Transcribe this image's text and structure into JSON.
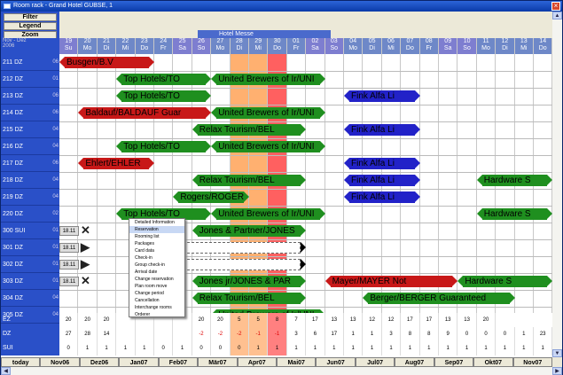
{
  "window": {
    "title": "Room rack - Grand Hotel GUBSE, 1"
  },
  "buttons": {
    "filter": "Filter",
    "legend": "Legend",
    "zoom": "Zoom"
  },
  "header": {
    "month_range": "Nov - Dez",
    "year": "2006",
    "event": "Hotel Messe"
  },
  "days": [
    {
      "d": "19",
      "w": "Su"
    },
    {
      "d": "20",
      "w": "Mo"
    },
    {
      "d": "21",
      "w": "Di"
    },
    {
      "d": "22",
      "w": "Mi"
    },
    {
      "d": "23",
      "w": "Do"
    },
    {
      "d": "24",
      "w": "Fr"
    },
    {
      "d": "25",
      "w": "Sa"
    },
    {
      "d": "26",
      "w": "So"
    },
    {
      "d": "27",
      "w": "Mo"
    },
    {
      "d": "28",
      "w": "Di"
    },
    {
      "d": "29",
      "w": "Mi"
    },
    {
      "d": "30",
      "w": "Do"
    },
    {
      "d": "01",
      "w": "Fr"
    },
    {
      "d": "02",
      "w": "Sa"
    },
    {
      "d": "03",
      "w": "So"
    },
    {
      "d": "04",
      "w": "Mo"
    },
    {
      "d": "05",
      "w": "Di"
    },
    {
      "d": "06",
      "w": "Mi"
    },
    {
      "d": "07",
      "w": "Do"
    },
    {
      "d": "08",
      "w": "Fr"
    },
    {
      "d": "09",
      "w": "Sa"
    },
    {
      "d": "10",
      "w": "So"
    },
    {
      "d": "11",
      "w": "Mo"
    },
    {
      "d": "12",
      "w": "Di"
    },
    {
      "d": "13",
      "w": "Mi"
    },
    {
      "d": "14",
      "w": "Do"
    }
  ],
  "rooms": [
    {
      "name": "211 DZ",
      "n": "06"
    },
    {
      "name": "212 DZ",
      "n": "01"
    },
    {
      "name": "213 DZ",
      "n": "06"
    },
    {
      "name": "214 DZ",
      "n": "06"
    },
    {
      "name": "215 DZ",
      "n": "04"
    },
    {
      "name": "216 DZ",
      "n": "04"
    },
    {
      "name": "217 DZ",
      "n": "06"
    },
    {
      "name": "218 DZ",
      "n": "04"
    },
    {
      "name": "219 DZ",
      "n": "04"
    },
    {
      "name": "220 DZ",
      "n": "02"
    },
    {
      "name": "300 SUI",
      "n": "01"
    },
    {
      "name": "301 DZ",
      "n": "01"
    },
    {
      "name": "302 DZ",
      "n": "01"
    },
    {
      "name": "303 DZ",
      "n": "01"
    },
    {
      "name": "304 DZ",
      "n": "04"
    },
    {
      "name": "305 DZ",
      "n": "04"
    }
  ],
  "bookings": [
    {
      "row": 0,
      "s": 0,
      "e": 5,
      "c": "red",
      "t": "Busgen/B.V"
    },
    {
      "row": 1,
      "s": 3,
      "e": 8,
      "c": "g",
      "t": "Top Hotels/TO"
    },
    {
      "row": 1,
      "s": 8,
      "e": 14,
      "c": "g",
      "t": "United Brewers of Ir/UNI"
    },
    {
      "row": 2,
      "s": 3,
      "e": 8,
      "c": "g",
      "t": "Top Hotels/TO"
    },
    {
      "row": 2,
      "s": 15,
      "e": 19,
      "c": "b",
      "t": "Fink Alfa Li"
    },
    {
      "row": 3,
      "s": 1,
      "e": 8,
      "c": "red",
      "t": "Baldauf/BALDAUF Guar"
    },
    {
      "row": 3,
      "s": 8,
      "e": 14,
      "c": "g",
      "t": "United Brewers of Ir/UNI"
    },
    {
      "row": 4,
      "s": 7,
      "e": 13,
      "c": "g",
      "t": "Relax Tourism/BEL"
    },
    {
      "row": 4,
      "s": 15,
      "e": 19,
      "c": "b",
      "t": "Fink Alfa Li"
    },
    {
      "row": 5,
      "s": 3,
      "e": 8,
      "c": "g",
      "t": "Top Hotels/TO"
    },
    {
      "row": 5,
      "s": 8,
      "e": 14,
      "c": "g",
      "t": "United Brewers of Ir/UNI"
    },
    {
      "row": 6,
      "s": 1,
      "e": 5,
      "c": "red",
      "t": "Ehlert/EHLER"
    },
    {
      "row": 6,
      "s": 15,
      "e": 19,
      "c": "b",
      "t": "Fink Alfa Li"
    },
    {
      "row": 7,
      "s": 7,
      "e": 13,
      "c": "g",
      "t": "Relax Tourism/BEL"
    },
    {
      "row": 7,
      "s": 15,
      "e": 19,
      "c": "b",
      "t": "Fink Alfa Li"
    },
    {
      "row": 7,
      "s": 22,
      "e": 26,
      "c": "g",
      "t": "Hardware S"
    },
    {
      "row": 8,
      "s": 6,
      "e": 10,
      "c": "g",
      "t": "Rogers/ROGER"
    },
    {
      "row": 8,
      "s": 15,
      "e": 19,
      "c": "b",
      "t": "Fink Alfa Li"
    },
    {
      "row": 9,
      "s": 3,
      "e": 8,
      "c": "g",
      "t": "Top Hotels/TO"
    },
    {
      "row": 9,
      "s": 8,
      "e": 14,
      "c": "g",
      "t": "United Brewers of Ir/UNI"
    },
    {
      "row": 9,
      "s": 22,
      "e": 26,
      "c": "g",
      "t": "Hardware S"
    },
    {
      "row": 10,
      "s": 7,
      "e": 13,
      "c": "g",
      "t": "Jones & Partner/JONES"
    },
    {
      "row": 11,
      "s": 6,
      "e": 13,
      "c": "w",
      "t": ""
    },
    {
      "row": 12,
      "s": 6,
      "e": 13,
      "c": "w",
      "t": ""
    },
    {
      "row": 13,
      "s": 7,
      "e": 13,
      "c": "g",
      "t": "Jones jr/JONES & PAR"
    },
    {
      "row": 13,
      "s": 14,
      "e": 21,
      "c": "red",
      "t": "Mayer/MAYER Not"
    },
    {
      "row": 13,
      "s": 21,
      "e": 26,
      "c": "g",
      "t": "Hardware S"
    },
    {
      "row": 14,
      "s": 7,
      "e": 13,
      "c": "g",
      "t": "Relax Tourism/BEL"
    },
    {
      "row": 14,
      "s": 16,
      "e": 24,
      "c": "g",
      "t": "Berger/BERGER Guaranteed"
    },
    {
      "row": 15,
      "s": 8,
      "e": 14,
      "c": "g",
      "t": "United Brewers of Ir/UNI"
    }
  ],
  "checkin_tags": [
    "18.11",
    "18.11",
    "18.11",
    "18.11",
    "18.11"
  ],
  "context_menu": [
    "Detailed Information",
    "Reservation",
    "Rooming list",
    "Packages",
    "Card data",
    "Check-in",
    "Group check-in",
    "Arrival date",
    "Change reservation",
    "Plan room move",
    "Change period",
    "Cancellation",
    "Interchange rooms",
    "Orderer"
  ],
  "context_selected": 1,
  "summary": {
    "labels": [
      "EZ",
      "DZ",
      "SUI"
    ],
    "ez": [
      "20",
      "20",
      "20",
      "",
      "",
      "",
      "",
      "20",
      "20",
      "5",
      "5",
      "8",
      "7",
      "17",
      "13",
      "13",
      "12",
      "12",
      "17",
      "17",
      "13",
      "13",
      "20"
    ],
    "dz": [
      "27",
      "28",
      "14",
      "",
      "",
      "",
      "",
      "-2",
      "-2",
      "-2",
      "-1",
      "-1",
      "3",
      "6",
      "17",
      "1",
      "1",
      "3",
      "8",
      "8",
      "9",
      "0",
      "0",
      "0",
      "1",
      "23"
    ],
    "sui": [
      "0",
      "1",
      "1",
      "1",
      "1",
      "0",
      "1",
      "0",
      "0",
      "0",
      "1",
      "1",
      "1",
      "1",
      "1",
      "1",
      "1",
      "1",
      "1",
      "1",
      "1",
      "1",
      "1",
      "1",
      "1",
      "1"
    ]
  },
  "months": [
    "today",
    "Nov06",
    "Dez06",
    "Jan07",
    "Feb07",
    "Mär07",
    "Apr07",
    "Mai07",
    "Jun07",
    "Jul07",
    "Aug07",
    "Sep07",
    "Okt07",
    "Nov07"
  ],
  "colors": {
    "green": "#1f8f1f",
    "blue": "#2222c8",
    "red": "#c81818",
    "highlight": "#ff9040"
  }
}
